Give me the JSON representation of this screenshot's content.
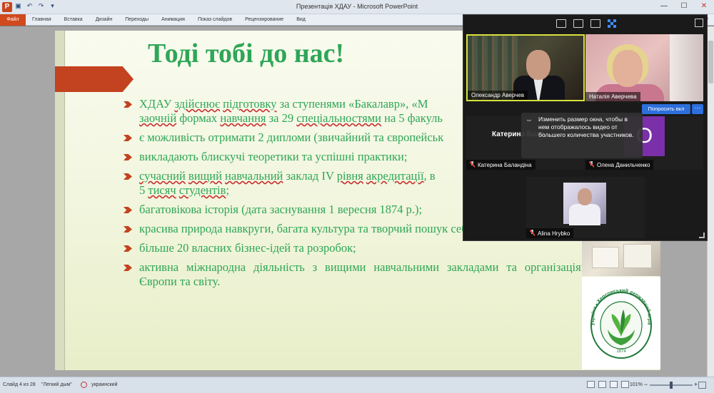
{
  "window": {
    "title": "Презентація ХДАУ  -  Microsoft PowerPoint",
    "app_icon": "P",
    "qat_icons": [
      "save-icon",
      "undo-icon",
      "redo-icon",
      "customize-icon"
    ],
    "controls": {
      "minimize": "—",
      "maximize": "☐",
      "close": "✕"
    }
  },
  "ribbon": {
    "file_tab": "Файл",
    "tabs": [
      "Главная",
      "Вставка",
      "Дизайн",
      "Переходы",
      "Анимация",
      "Показ слайдов",
      "Рецензирование",
      "Вид"
    ],
    "help": "?"
  },
  "slide": {
    "title": "Тоді тобі до нас!",
    "bullets": [
      {
        "parts": [
          {
            "t": "ХДАУ  ",
            "u": false
          },
          {
            "t": "здійснює",
            "u": true
          },
          {
            "t": " ",
            "u": false
          },
          {
            "t": "підготовку",
            "u": true
          },
          {
            "t": " за ступенями «Бакалавр», «М",
            "u": false
          },
          {
            "t": "\n",
            "u": false
          },
          {
            "t": "заочній",
            "u": true
          },
          {
            "t": " формах ",
            "u": false
          },
          {
            "t": "навчання",
            "u": true
          },
          {
            "t": " за  29 ",
            "u": false
          },
          {
            "t": "спеціальностями",
            "u": true
          },
          {
            "t": " на 5 факуль",
            "u": false
          }
        ]
      },
      {
        "parts": [
          {
            "t": "є можливість отримати 2 дипломи (звичайний та європейськ",
            "u": false
          }
        ]
      },
      {
        "parts": [
          {
            "t": "викладають блискучі теоретики та успішні практики;",
            "u": false
          }
        ]
      },
      {
        "parts": [
          {
            "t": "сучасний",
            "u": true
          },
          {
            "t": " ",
            "u": false
          },
          {
            "t": "вищий",
            "u": true
          },
          {
            "t": " ",
            "u": false
          },
          {
            "t": "навчальний",
            "u": true
          },
          {
            "t": " заклад IV ",
            "u": false
          },
          {
            "t": "рівня",
            "u": true
          },
          {
            "t": " ",
            "u": false
          },
          {
            "t": "акредитації",
            "u": true
          },
          {
            "t": ", в",
            "u": false
          },
          {
            "t": "\n",
            "u": false
          },
          {
            "t": "5 ",
            "u": false
          },
          {
            "t": "тисяч",
            "u": true
          },
          {
            "t": " ",
            "u": false
          },
          {
            "t": "студентів",
            "u": true
          },
          {
            "t": ";",
            "u": false
          }
        ]
      },
      {
        "parts": [
          {
            "t": "багатовікова історія (дата заснування 1 вересня 1874 р.);",
            "u": false
          }
        ]
      },
      {
        "parts": [
          {
            "t": "красива природа навкруги, багата культура та творчий пошук себе;",
            "u": false
          }
        ]
      },
      {
        "parts": [
          {
            "t": "більше 20 власних бізнес-ідей та  розробок;",
            "u": false
          }
        ]
      },
      {
        "parts": [
          {
            "t": "активна  міжнародна  діяльність  з  вищими  навчальними  закладами  та організаціями Європи та світу.",
            "u": false
          }
        ],
        "justify": true
      }
    ],
    "logo": {
      "ring_text": "Україна • Херсонський державний аграрний університет",
      "year": "1874"
    }
  },
  "zoom": {
    "top_icons": [
      "grid-view-icon",
      "gallery-view-icon",
      "speaker-view-icon",
      "thumbnail-view-icon"
    ],
    "participants": [
      {
        "name": "Олександр Аверчев",
        "muted": false
      },
      {
        "name": "Наталія Аверчева",
        "muted": false
      },
      {
        "name": "Катерина Баландіна",
        "muted": true,
        "display_name": "Катерина  Бала"
      },
      {
        "name": "Олена Данильченко",
        "muted": true,
        "avatar_letter": "О"
      },
      {
        "name": "Alina Hrybko",
        "muted": true
      }
    ],
    "ask_button": "Попросить вкл",
    "more_button": "···",
    "tooltip": "Изменить размер окна, чтобы в нем отображалось видео от большего количества участников."
  },
  "status": {
    "slide_info": "Слайд 4 из 28",
    "theme": "\"Легкий дым\"",
    "language": "украинский",
    "zoom": "101%",
    "zoom_minus": "−",
    "zoom_plus": "+"
  }
}
